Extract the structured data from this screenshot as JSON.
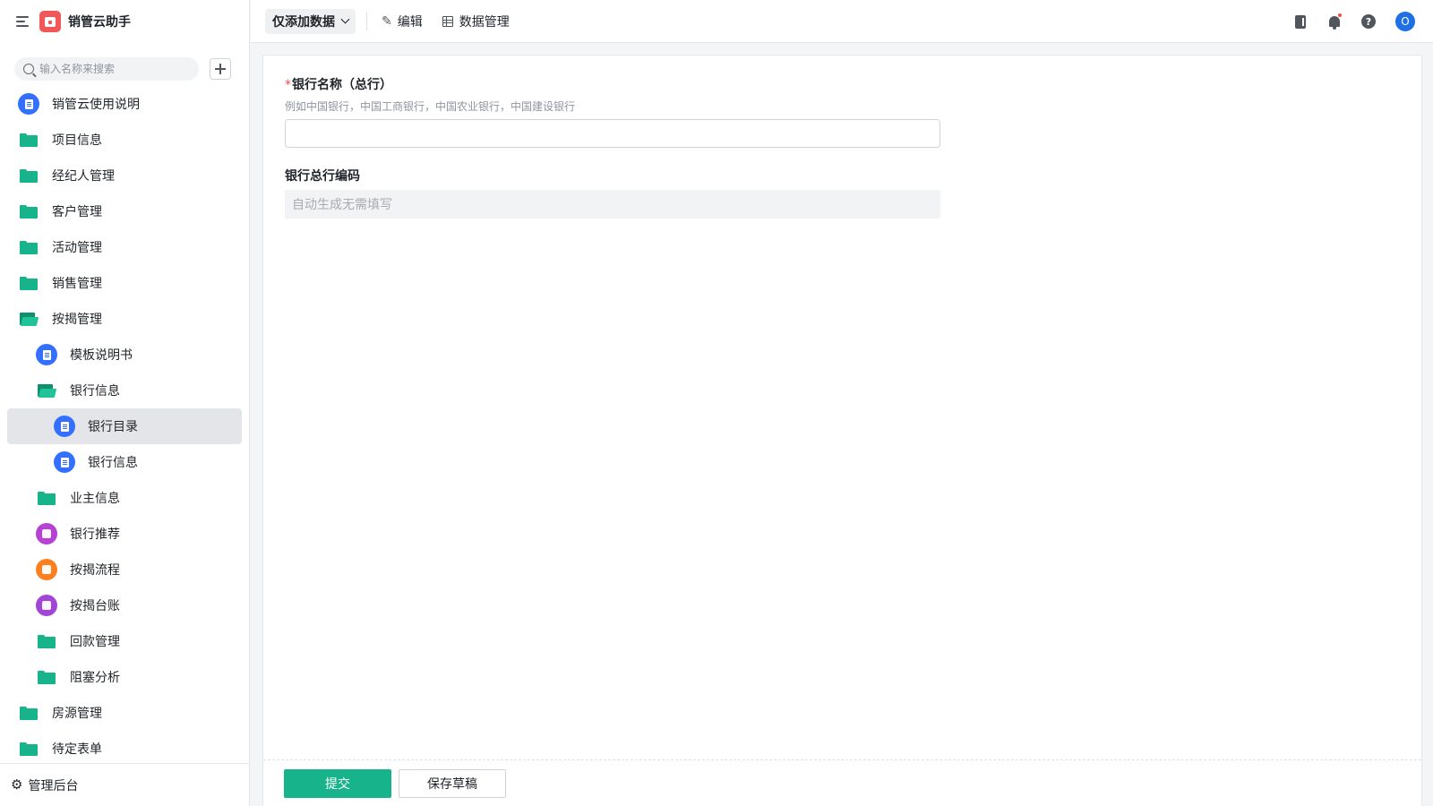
{
  "app": {
    "title": "销管云助手"
  },
  "search": {
    "placeholder": "输入名称来搜索"
  },
  "sidebar": {
    "items": [
      {
        "label": "销管云使用说明",
        "icon": "doc-icon",
        "level": 0
      },
      {
        "label": "项目信息",
        "icon": "folder-icon",
        "level": 0
      },
      {
        "label": "经纪人管理",
        "icon": "folder-icon",
        "level": 0
      },
      {
        "label": "客户管理",
        "icon": "folder-icon",
        "level": 0
      },
      {
        "label": "活动管理",
        "icon": "folder-icon",
        "level": 0
      },
      {
        "label": "销售管理",
        "icon": "folder-icon",
        "level": 0
      },
      {
        "label": "按揭管理",
        "icon": "folder-open-icon",
        "level": 0
      },
      {
        "label": "模板说明书",
        "icon": "doc-icon",
        "level": 1
      },
      {
        "label": "银行信息",
        "icon": "folder-open-icon",
        "level": 1
      },
      {
        "label": "银行目录",
        "icon": "doc-icon",
        "level": 2,
        "active": true
      },
      {
        "label": "银行信息",
        "icon": "doc-icon",
        "level": 2
      },
      {
        "label": "业主信息",
        "icon": "folder-icon",
        "level": 1
      },
      {
        "label": "银行推荐",
        "icon": "recommend-icon",
        "level": 1
      },
      {
        "label": "按揭流程",
        "icon": "workflow-icon",
        "level": 1
      },
      {
        "label": "按揭台账",
        "icon": "dashboard-icon",
        "level": 1
      },
      {
        "label": "回款管理",
        "icon": "folder-icon",
        "level": 1
      },
      {
        "label": "阻塞分析",
        "icon": "folder-icon",
        "level": 1
      },
      {
        "label": "房源管理",
        "icon": "folder-icon",
        "level": 0
      },
      {
        "label": "待定表单",
        "icon": "folder-icon",
        "level": 0
      }
    ],
    "footer_label": "管理后台"
  },
  "toolbar": {
    "view_select": "仅添加数据",
    "edit_label": "编辑",
    "data_manage_label": "数据管理",
    "avatar_initial": "O",
    "help_glyph": "?"
  },
  "form": {
    "field1": {
      "label": "银行名称（总行）",
      "required_mark": "*",
      "hint": "例如中国银行，中国工商银行，中国农业银行，中国建设银行",
      "value": ""
    },
    "field2": {
      "label": "银行总行编码",
      "placeholder": "自动生成无需填写"
    },
    "submit_label": "提交",
    "draft_label": "保存草稿"
  },
  "colors": {
    "accent": "#17b38a",
    "logo": "#f25757",
    "doc_icon": "#3370ff",
    "avatar": "#1f6fe5"
  }
}
